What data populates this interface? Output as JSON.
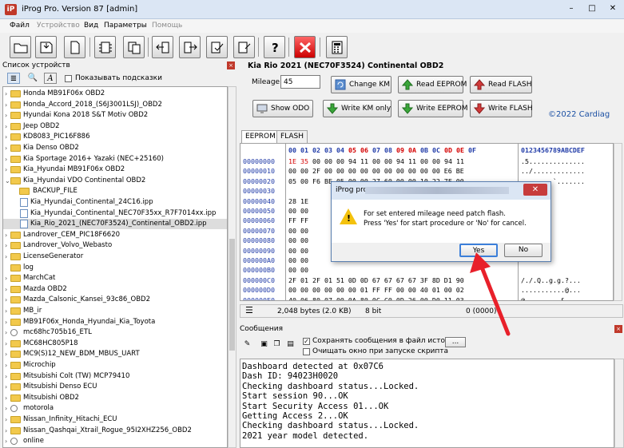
{
  "window": {
    "title": "iProg Pro. Version 87 [admin]",
    "app_icon": "iP",
    "minimize": "–",
    "maximize": "□",
    "close": "✕"
  },
  "menu": [
    {
      "label": "Файл",
      "enabled": true
    },
    {
      "label": "Устройство",
      "enabled": false
    },
    {
      "label": "Вид",
      "enabled": true
    },
    {
      "label": "Параметры",
      "enabled": true
    },
    {
      "label": "Помощь",
      "enabled": false
    }
  ],
  "left_panel": {
    "title": "Список устройств",
    "close": "×",
    "show_hints_label": "Показывать подсказки",
    "items": [
      {
        "label": "Honda MB91F06x OBD2",
        "type": "folder",
        "expander": "›"
      },
      {
        "label": "Honda_Accord_2018_(S6J3001LSJ)_OBD2",
        "type": "folder",
        "expander": "›"
      },
      {
        "label": "Hyundai Kona 2018 S&T Motiv OBD2",
        "type": "folder",
        "expander": "›"
      },
      {
        "label": "Jeep OBD2",
        "type": "folder",
        "expander": "›"
      },
      {
        "label": "KD8083_PIC16F886",
        "type": "folder",
        "expander": "›"
      },
      {
        "label": "Kia Denso OBD2",
        "type": "folder",
        "expander": "›"
      },
      {
        "label": "Kia Sportage 2016+ Yazaki (NEC+25160)",
        "type": "folder",
        "expander": "›"
      },
      {
        "label": "Kia_Hyundai MB91F06x OBD2",
        "type": "folder",
        "expander": "›"
      },
      {
        "label": "Kia_Hyundai VDO Continental OBD2",
        "type": "folder",
        "expander": "⌄"
      },
      {
        "label": "BACKUP_FILE",
        "type": "subfolder",
        "expander": ""
      },
      {
        "label": "Kia_Hyundai_Continental_24C16.ipp",
        "type": "file",
        "expander": ""
      },
      {
        "label": "Kia_Hyundai_Continental_NEC70F35xx_R7F7014xx.ipp",
        "type": "file",
        "expander": ""
      },
      {
        "label": "Kia_Rio_2021_(NEC70F3524)_Continental_OBD2.ipp",
        "type": "file",
        "expander": "",
        "selected": true
      },
      {
        "label": "Landrover_CEM_PIC18F6620",
        "type": "folder",
        "expander": "›"
      },
      {
        "label": "Landrover_Volvo_Webasto",
        "type": "folder",
        "expander": "›"
      },
      {
        "label": "LicenseGenerator",
        "type": "folder",
        "expander": "›"
      },
      {
        "label": "log",
        "type": "folder",
        "expander": ""
      },
      {
        "label": "MarchCat",
        "type": "folder",
        "expander": "›"
      },
      {
        "label": "Mazda OBD2",
        "type": "folder",
        "expander": "›"
      },
      {
        "label": "Mazda_Calsonic_Kansei_93c86_OBD2",
        "type": "folder",
        "expander": "›"
      },
      {
        "label": "MB_ir",
        "type": "folder",
        "expander": "›"
      },
      {
        "label": "MB91F06x_Honda_Hyundai_Kia_Toyota",
        "type": "folder",
        "expander": "›"
      },
      {
        "label": "mc68hc705b16_ETL",
        "type": "file",
        "expander": "›"
      },
      {
        "label": "MC68HC805P18",
        "type": "folder",
        "expander": "›"
      },
      {
        "label": "MC9(S)12_NEW_BDM_MBUS_UART",
        "type": "folder",
        "expander": "›"
      },
      {
        "label": "Microchip",
        "type": "folder",
        "expander": "›"
      },
      {
        "label": "Mitsubishi Colt (TW) MCP79410",
        "type": "folder",
        "expander": "›"
      },
      {
        "label": "Mitsubishi Denso ECU",
        "type": "folder",
        "expander": "›"
      },
      {
        "label": "Mitsubishi OBD2",
        "type": "folder",
        "expander": "›"
      },
      {
        "label": "motorola",
        "type": "file",
        "expander": "›"
      },
      {
        "label": "Nissan_Infinity_Hitachi_ECU",
        "type": "folder",
        "expander": "›"
      },
      {
        "label": "Nissan_Qashqai_Xtrail_Rogue_95I2XHZ256_OBD2",
        "type": "folder",
        "expander": "›"
      },
      {
        "label": "online",
        "type": "file",
        "expander": "›"
      }
    ]
  },
  "product": {
    "title": "Kia Rio 2021 (NEC70F3524) Continental OBD2",
    "mileage_label": "Mileage:",
    "mileage_value": "45",
    "copyright": "©2022 Cardiag",
    "buttons": {
      "change_km": "Change KM",
      "read_eeprom": "Read EEPROM",
      "read_flash": "Read FLASH",
      "show_odo": "Show ODO",
      "write_km_only": "Write KM only",
      "write_eeprom": "Write EEPROM",
      "write_flash": "Write FLASH"
    }
  },
  "hex": {
    "tabs": [
      "EEPROM",
      "FLASH"
    ],
    "header_addr": "",
    "header_bytes": "00 01 02 03 04 05 06 07 08 09 0A 0B 0C 0D 0E 0F",
    "header_ascii": "0123456789ABCDEF",
    "rows": [
      {
        "addr": "00000000",
        "bytes": "1E 35 00 00 00 94 11 00 00 94 11 00 00 94 11",
        "ascii": ".5.............."
      },
      {
        "addr": "00000010",
        "bytes": "00 00 2F 00 00 00 00 00 00 00 00 00 00 E6 BE",
        "ascii": "../............."
      },
      {
        "addr": "00000020",
        "bytes": "05 00 F6 BE 05 00 00 27 60 00 00 10 22 7F 00",
        "ascii": "........`......."
      },
      {
        "addr": "00000030",
        "bytes": "",
        "ascii": ""
      },
      {
        "addr": "00000040",
        "bytes": "28 1E",
        "ascii": ".U...$."
      },
      {
        "addr": "00000050",
        "bytes": "00 00",
        "ascii": ""
      },
      {
        "addr": "00000060",
        "bytes": "FF FF",
        "ascii": ""
      },
      {
        "addr": "00000070",
        "bytes": "00 00",
        "ascii": ""
      },
      {
        "addr": "00000080",
        "bytes": "00 00",
        "ascii": ""
      },
      {
        "addr": "00000090",
        "bytes": "00 00",
        "ascii": ""
      },
      {
        "addr": "000000A0",
        "bytes": "00 00",
        "ascii": ""
      },
      {
        "addr": "000000B0",
        "bytes": "00 00",
        "ascii": ""
      },
      {
        "addr": "000000C0",
        "bytes": "2F 01 2F 01 51 0D 0D 67 67 67 67 3F 8D D1 90",
        "ascii": "/./.Q..g.g.?..."
      },
      {
        "addr": "000000D0",
        "bytes": "00 00 00 00 00 00 01 FF FF 00 00 40 01 00 02",
        "ascii": "...........@..."
      },
      {
        "addr": "000000E0",
        "bytes": "40 06 80 07 00 0A 80 0C C0 0D 26 00 D0 11 03",
        "ascii": "@.........&....."
      }
    ]
  },
  "status": {
    "bytes": "2,048 bytes (2.0 KB)",
    "bits": "8 bit",
    "position": "0 (0000)"
  },
  "dialog": {
    "title": "iProg pro",
    "close": "✕",
    "message_line1": "For set entered mileage need patch flash.",
    "message_line2": "Press 'Yes' for start procedure or 'No' for cancel.",
    "yes": "Yes",
    "no": "No"
  },
  "messages": {
    "title": "Сообщения",
    "close": "×",
    "save_to_history_label": "Сохранять сообщения в файл истории",
    "save_to_history_checked": true,
    "save_check_mark": "✓",
    "clear_on_start_label": "Очищать окно при запуске скрипта",
    "clear_on_start_checked": false,
    "browse_button": "...",
    "log": [
      "Dashboard detected at 0x07C6",
      "Dash ID: 94023H0020",
      "Checking dashboard status...Locked.",
      "Start session 90...OK",
      "Start Security Access 01...OK",
      "Getting Access 2...OK",
      "Checking dashboard status...Locked.",
      "2021 year model detected."
    ]
  },
  "colors": {
    "accent_blue": "#1f3aa7",
    "changed_byte_red": "#d40000",
    "arrow_red": "#e8202a"
  }
}
